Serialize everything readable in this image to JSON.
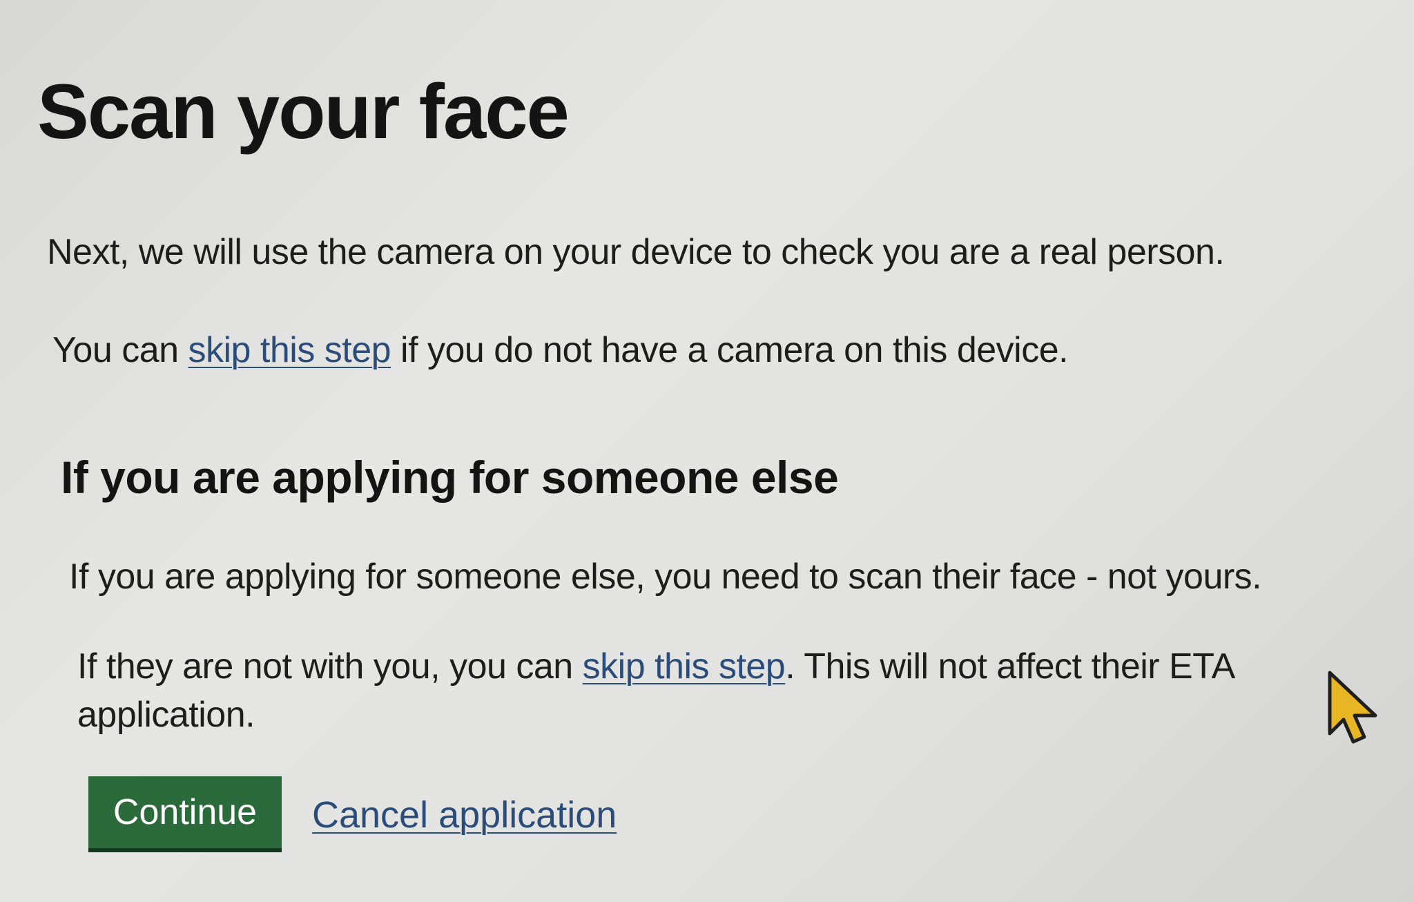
{
  "page": {
    "title": "Scan your face",
    "intro_text": "Next, we will use the camera on your device to check you are a real person.",
    "skip_before": "You can ",
    "skip_link": "skip this step",
    "skip_after": " if you do not have a camera on this device."
  },
  "someone_else": {
    "heading": "If you are applying for someone else",
    "body_text": "If you are applying for someone else, you need to scan their face - not yours.",
    "skip_before": "If they are not with you, you can ",
    "skip_link": "skip this step",
    "skip_after": ". This will not affect their ETA application."
  },
  "actions": {
    "continue_label": "Continue",
    "cancel_label": "Cancel application"
  },
  "colors": {
    "button_green": "#2b6a3a",
    "link_blue": "#2a4c7a",
    "cursor_yellow": "#e8b625"
  },
  "icons": {
    "cursor": "mouse-pointer-icon"
  }
}
